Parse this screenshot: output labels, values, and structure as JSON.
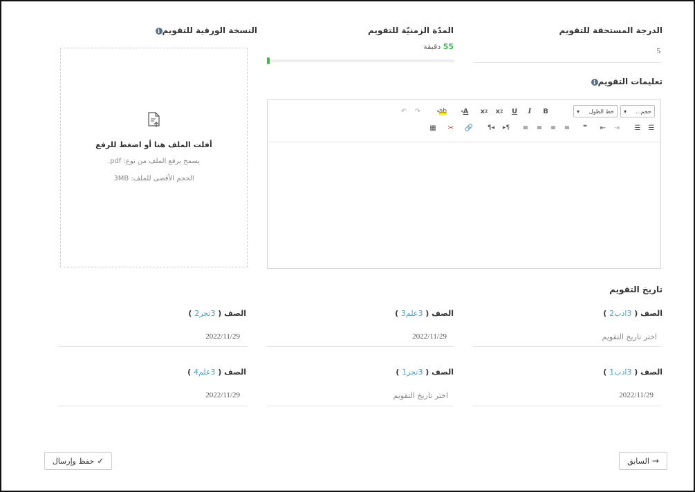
{
  "grade": {
    "label": "الدرجة المستحقة للتقويم",
    "value": "5"
  },
  "duration": {
    "label": "المدّة الزمنيّة للتقويم",
    "number": "55",
    "unit": "دقيقة",
    "progress_fraction": 0.01,
    "accent": "#4caf50"
  },
  "paper": {
    "label": "النسخة الورقية للتقويم",
    "upload_title": "أفلت الملف هنا أو اضغط للرفع",
    "allowed_types": "يسمح برفع الملف من نوع: pdf.",
    "max_size": "الحجم الأقصى للملف: 3MB"
  },
  "instructions": {
    "label": "تعليمات التقويم",
    "toolbar": {
      "size_select": "حجم...",
      "font_select": "خط الطول"
    }
  },
  "eval_date": {
    "label": "تاريخ التقويم",
    "placeholder": "اختر تاريخ التقويم",
    "classes": [
      {
        "prefix": "الصف ( ",
        "code": "3ادب2",
        "suffix": " )",
        "date": ""
      },
      {
        "prefix": "الصف ( ",
        "code": "3علم3",
        "suffix": " )",
        "date": "2022/11/29"
      },
      {
        "prefix": "الصف ( ",
        "code": "3تجر2",
        "suffix": " )",
        "date": "2022/11/29"
      },
      {
        "prefix": "الصف ( ",
        "code": "3ادب1",
        "suffix": " )",
        "date": "2022/11/29"
      },
      {
        "prefix": "الصف ( ",
        "code": "3تجر1",
        "suffix": " )",
        "date": ""
      },
      {
        "prefix": "الصف ( ",
        "code": "3علم4",
        "suffix": " )",
        "date": "2022/11/29"
      }
    ]
  },
  "actions": {
    "previous": "السابق",
    "save_send": "حفظ وإرسال"
  },
  "colors": {
    "link": "#4aa0c8",
    "info_badge": "#5a6f83"
  }
}
